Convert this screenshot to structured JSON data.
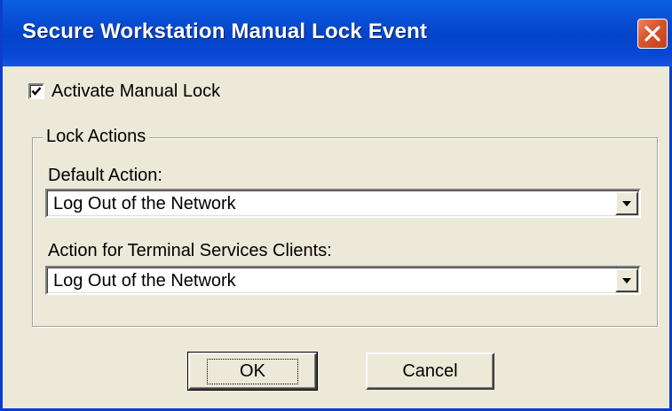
{
  "window": {
    "title": "Secure Workstation Manual Lock Event",
    "close_icon": "close-x-icon",
    "close_color": "#d8542c",
    "titlebar_color": "#0244c9"
  },
  "activate": {
    "label": "Activate Manual Lock",
    "checked": true
  },
  "lock_actions": {
    "group_label": "Lock Actions",
    "default_action": {
      "label": "Default Action:",
      "value": "Log Out of the Network"
    },
    "terminal_action": {
      "label": "Action for Terminal Services Clients:",
      "value": "Log Out of the Network"
    }
  },
  "buttons": {
    "ok": "OK",
    "cancel": "Cancel"
  }
}
